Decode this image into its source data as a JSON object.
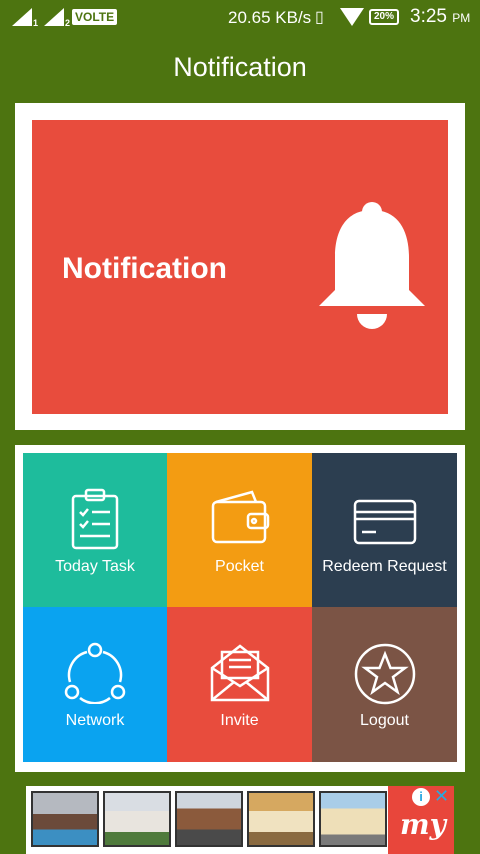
{
  "status_bar": {
    "sim1_sub": "1",
    "sim2_sub": "2",
    "volte": "VOLTE",
    "speed": "20.65 KB/s",
    "battery": "20%",
    "time": "3:25",
    "ampm": "PM"
  },
  "header": {
    "title": "Notification"
  },
  "banner": {
    "text": "Notification",
    "icon": "bell-icon"
  },
  "tiles": [
    {
      "label": "Today Task",
      "icon": "clipboard-icon",
      "color": "#1ebc9c"
    },
    {
      "label": "Pocket",
      "icon": "wallet-icon",
      "color": "#f39c12"
    },
    {
      "label": "Redeem Request",
      "icon": "credit-card-icon",
      "color": "#2c3e50"
    },
    {
      "label": "Network",
      "icon": "share-network-icon",
      "color": "#0aa3f0"
    },
    {
      "label": "Invite",
      "icon": "envelope-icon",
      "color": "#e84c3d"
    },
    {
      "label": "Logout",
      "icon": "star-icon",
      "color": "#7b5445"
    }
  ],
  "ad": {
    "brand": "my",
    "info_icon": "info-icon",
    "close_icon": "close-icon"
  }
}
